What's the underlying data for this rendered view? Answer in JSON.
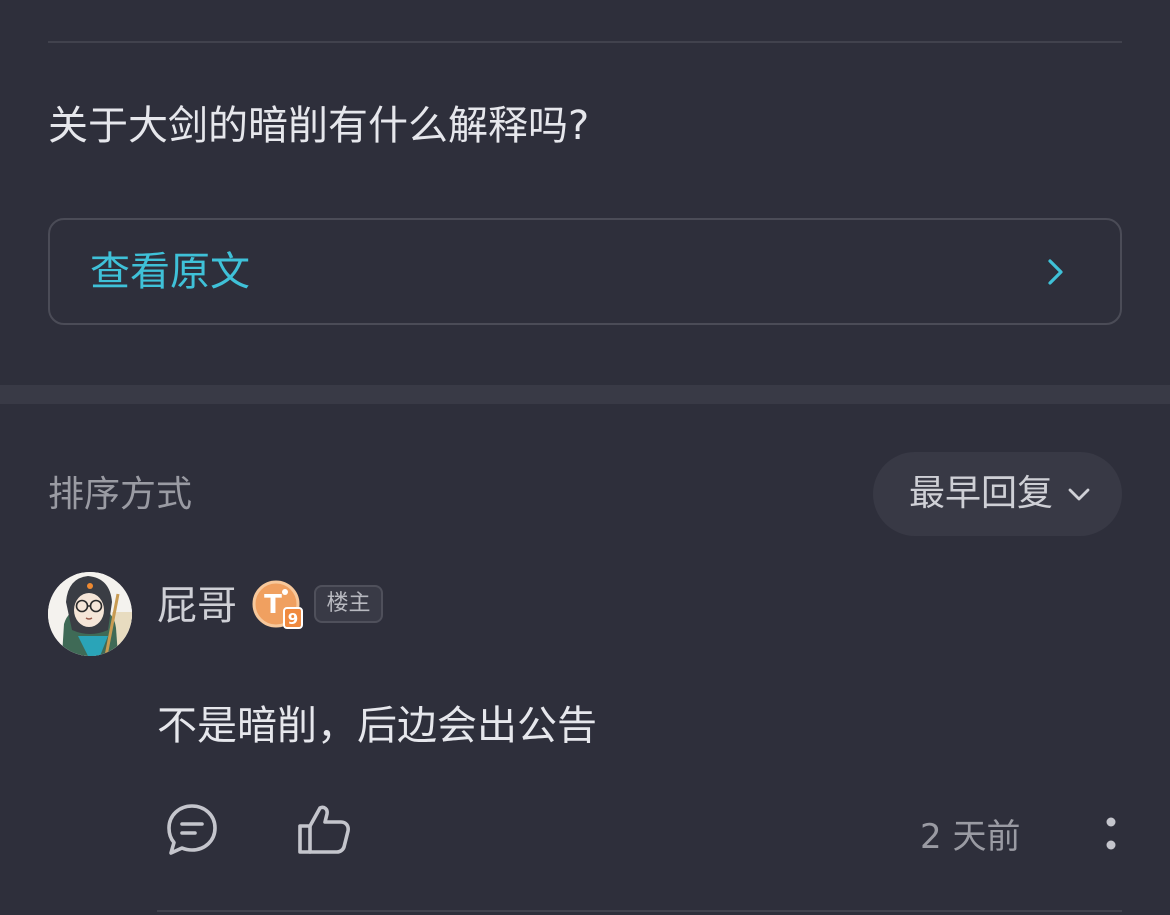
{
  "post": {
    "question": "关于大剑的暗削有什么解释吗?",
    "view_original_label": "查看原文"
  },
  "sort": {
    "label": "排序方式",
    "selected": "最早回复"
  },
  "reply": {
    "username": "屁哥",
    "level_badge": "T9",
    "owner_badge": "楼主",
    "content": "不是暗削，后边会出公告",
    "timestamp": "2 天前"
  },
  "colors": {
    "background": "#2e2f3b",
    "accent_link": "#3fc1d8",
    "level_badge": "#f0a060"
  },
  "icons": {
    "view_original": "chevron-right-icon",
    "sort": "chevron-down-icon",
    "comment": "comment-icon",
    "like": "thumbs-up-icon",
    "more": "more-vertical-icon"
  }
}
